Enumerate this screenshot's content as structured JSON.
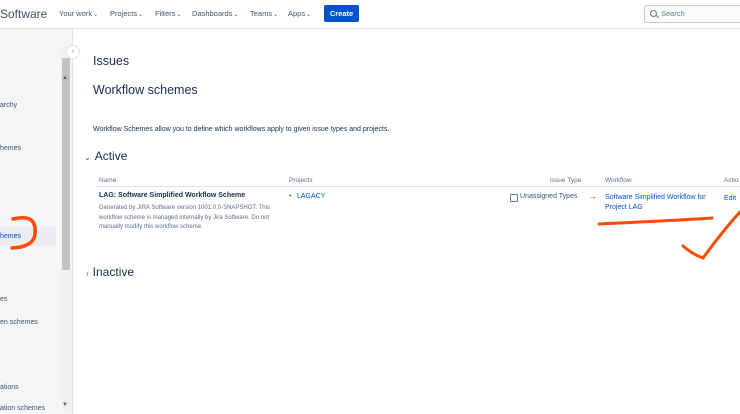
{
  "topbar": {
    "brand": "Software",
    "nav": [
      {
        "label": "Your work"
      },
      {
        "label": "Projects"
      },
      {
        "label": "Filters"
      },
      {
        "label": "Dashboards"
      },
      {
        "label": "Teams"
      },
      {
        "label": "Apps"
      }
    ],
    "create_label": "Create",
    "search_placeholder": "Search"
  },
  "sidebar": {
    "items": [
      {
        "label": "archy"
      },
      {
        "label": "hemes"
      },
      {
        "label": "hemes"
      },
      {
        "label": "es"
      },
      {
        "label": "en schemes"
      },
      {
        "label": "ations"
      },
      {
        "label": "ation schemes"
      }
    ]
  },
  "main": {
    "breadcrumb": "Issues",
    "title": "Workflow schemes",
    "description": "Workflow Schemes allow you to define which workflows apply to given issue types and projects.",
    "active_section": "Active",
    "inactive_section": "Inactive",
    "columns": [
      "Name",
      "Projects",
      "Issue Type",
      "Workflow",
      "Actio"
    ],
    "row": {
      "name": "LAG: Software Simplified Workflow Scheme",
      "description": "Generated by JIRA Software version 1001.0.0-SNAPSHOT. This workflow scheme is managed internally by Jira Software. Do not manually modify this workflow scheme.",
      "project": "LAGACY",
      "issue_type": "Unassigned Types",
      "arrow": "→",
      "workflow": "Software Simplified Workflow for Project LAG",
      "action": "Edit"
    }
  },
  "colors": {
    "primary": "#0052cc",
    "annotation": "#ff4a00"
  }
}
